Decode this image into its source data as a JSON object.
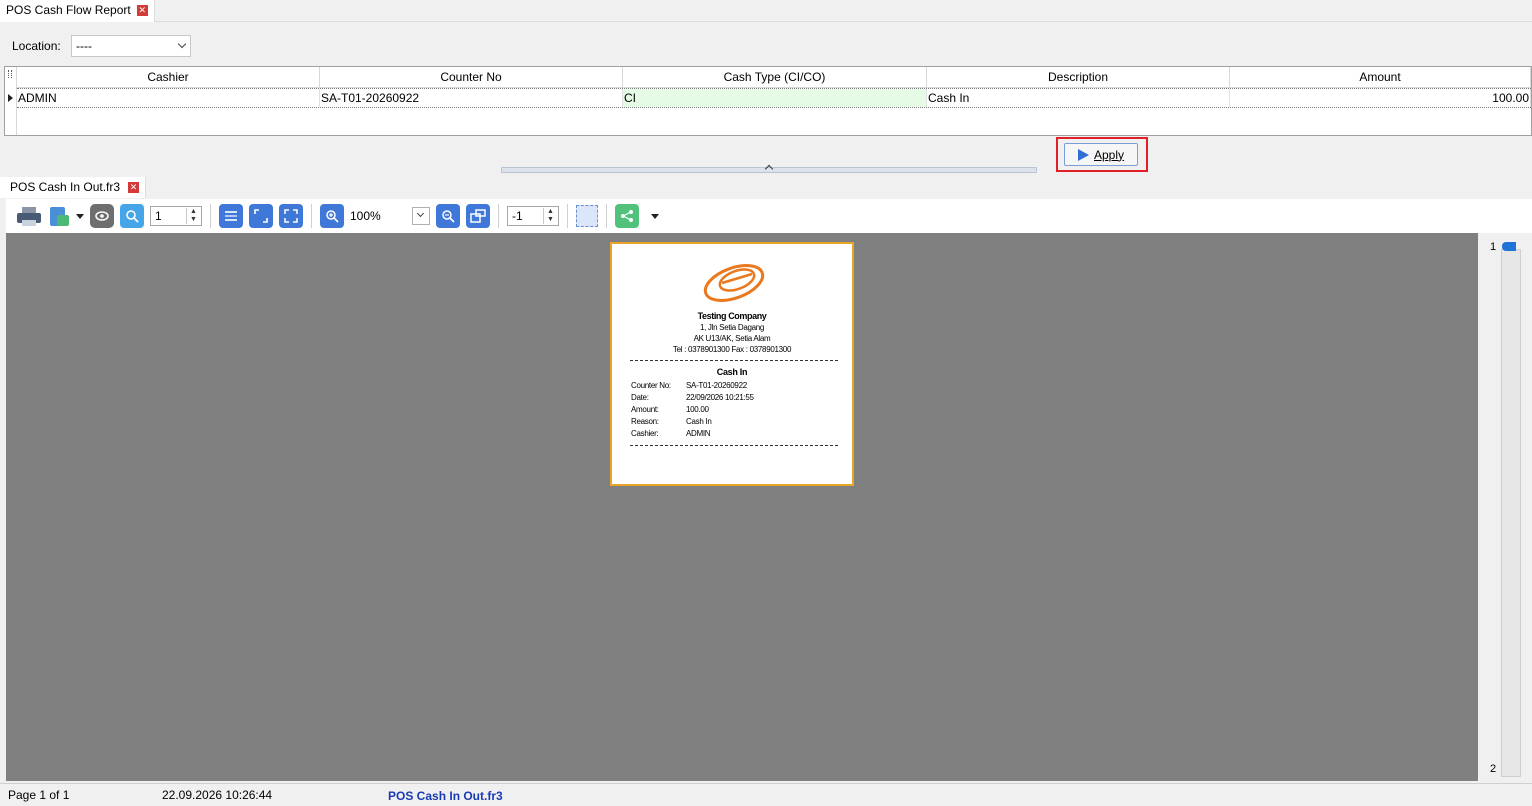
{
  "window": {
    "tab_title": "POS Cash Flow Report",
    "report_tab_title": "POS Cash In Out.fr3"
  },
  "filter": {
    "location_label": "Location:",
    "location_value": "----"
  },
  "grid": {
    "columns": [
      "Cashier",
      "Counter No",
      "Cash Type (CI/CO)",
      "Description",
      "Amount"
    ],
    "rows": [
      {
        "cashier": "ADMIN",
        "counter_no": "SA-T01-20260922",
        "cash_type": "CI",
        "description": "Cash In",
        "amount": "100.00"
      }
    ]
  },
  "apply": {
    "label": "Apply"
  },
  "toolbar": {
    "page_number": "1",
    "zoom": "100%",
    "second_spin": "-1"
  },
  "receipt": {
    "company": "Testing Company",
    "address1": "1, Jln Setia Dagang",
    "address2": "AK U13/AK, Setia Alam",
    "contact": "Tel : 0378901300    Fax : 0378901300",
    "title": "Cash In",
    "fields": {
      "counter_label": "Counter No:",
      "counter_value": "SA-T01-20260922",
      "date_label": "Date:",
      "date_value": "22/09/2026 10:21:55",
      "amount_label": "Amount:",
      "amount_value": "100.00",
      "reason_label": "Reason:",
      "reason_value": "Cash In",
      "cashier_label": "Cashier:",
      "cashier_value": "ADMIN"
    }
  },
  "pages_panel": {
    "first": "1",
    "last": "2"
  },
  "status": {
    "page": "Page 1 of 1",
    "timestamp": "22.09.2026 10:26:44",
    "file": "POS Cash In Out.fr3"
  },
  "colors": {
    "accent": "#3f78d8",
    "highlight_frame": "#e01f26",
    "selected_cell": "#e6fbe6",
    "page_border": "#e8a52a",
    "logo": "#e9781e"
  }
}
